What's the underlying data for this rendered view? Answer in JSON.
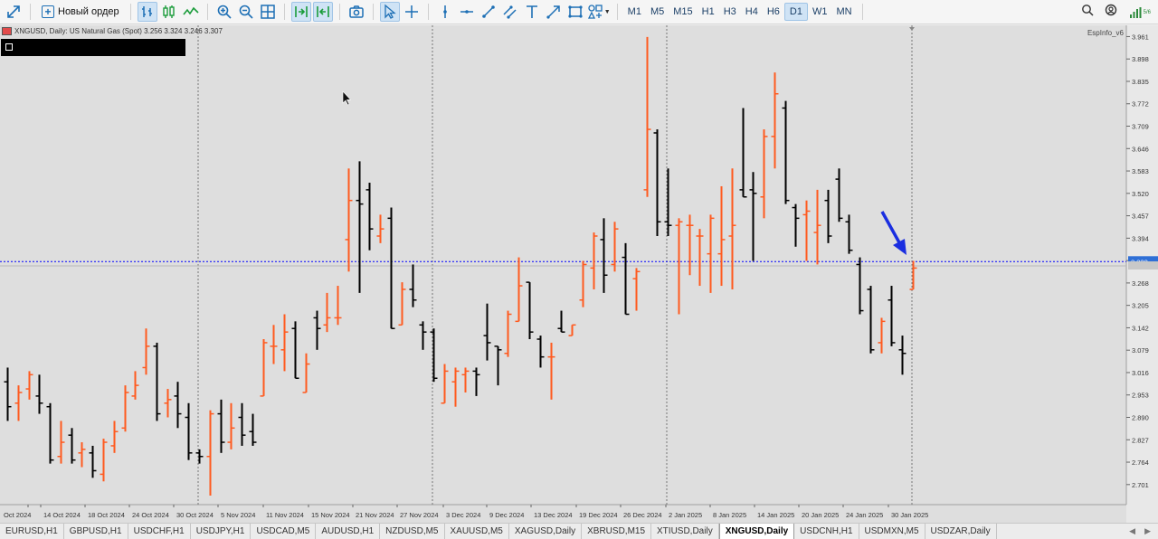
{
  "toolbar": {
    "new_order_label": "Новый ордер",
    "timeframes": [
      "M1",
      "M5",
      "M15",
      "H1",
      "H3",
      "H4",
      "H6",
      "D1",
      "W1",
      "MN"
    ],
    "active_timeframe": "D1",
    "icons": [
      "expand-icon",
      "new-order-icon",
      "bar-chart-icon",
      "candles-icon",
      "line-chart-icon",
      "zoom-in-icon",
      "zoom-out-icon",
      "grid-icon",
      "autoscroll-icon",
      "chart-shift-icon",
      "screenshot-icon",
      "cursor-icon",
      "crosshair-icon",
      "vertical-line-icon",
      "horizontal-line-icon",
      "trendline-icon",
      "channel-icon",
      "text-icon",
      "arrow-icon",
      "rectangle-icon",
      "shapes-icon",
      "search-icon",
      "community-icon",
      "signal-icon"
    ]
  },
  "chart": {
    "symbol_line": "XNGUSD, Daily:  US Natural Gas (Spot)  3.256 3.324 3.246 3.307",
    "indicator_label": "EspInfo_v6",
    "current_price_label": "3.328",
    "grid_line_color": "#0000ff",
    "up_color": "#ff5a1f",
    "down_color": "#000000",
    "price_ticks": [
      "3.961",
      "3.898",
      "3.835",
      "3.772",
      "3.709",
      "3.646",
      "3.583",
      "3.520",
      "3.457",
      "3.394",
      "3.331",
      "3.268",
      "3.205",
      "3.142",
      "3.079",
      "3.016",
      "2.953",
      "2.890",
      "2.827",
      "2.764",
      "2.701"
    ],
    "date_ticks": [
      "Oct 2024",
      "14 Oct 2024",
      "18 Oct 2024",
      "24 Oct 2024",
      "30 Oct 2024",
      "5 Nov 2024",
      "11 Nov 2024",
      "15 Nov 2024",
      "21 Nov 2024",
      "27 Nov 2024",
      "3 Dec 2024",
      "9 Dec 2024",
      "13 Dec 2024",
      "19 Dec 2024",
      "26 Dec 2024",
      "2 Jan 2025",
      "8 Jan 2025",
      "14 Jan 2025",
      "20 Jan 2025",
      "24 Jan 2025",
      "30 Jan 2025"
    ]
  },
  "chart_data": {
    "type": "ohlc",
    "symbol": "XNGUSD",
    "timeframe": "Daily",
    "ylim": [
      2.67,
      3.985
    ],
    "bars": [
      {
        "o": 2.99,
        "h": 3.03,
        "l": 2.88,
        "c": 2.92
      },
      {
        "o": 2.93,
        "h": 2.98,
        "l": 2.88,
        "c": 2.96
      },
      {
        "o": 2.97,
        "h": 3.02,
        "l": 2.94,
        "c": 3.01
      },
      {
        "o": 2.95,
        "h": 3.01,
        "l": 2.9,
        "c": 2.93
      },
      {
        "o": 2.92,
        "h": 2.93,
        "l": 2.76,
        "c": 2.77
      },
      {
        "o": 2.78,
        "h": 2.88,
        "l": 2.76,
        "c": 2.82
      },
      {
        "o": 2.84,
        "h": 2.86,
        "l": 2.76,
        "c": 2.77
      },
      {
        "o": 2.79,
        "h": 2.82,
        "l": 2.75,
        "c": 2.8
      },
      {
        "o": 2.79,
        "h": 2.81,
        "l": 2.72,
        "c": 2.74
      },
      {
        "o": 2.73,
        "h": 2.83,
        "l": 2.71,
        "c": 2.82
      },
      {
        "o": 2.81,
        "h": 2.88,
        "l": 2.79,
        "c": 2.85
      },
      {
        "o": 2.86,
        "h": 2.98,
        "l": 2.85,
        "c": 2.96
      },
      {
        "o": 2.95,
        "h": 3.02,
        "l": 2.94,
        "c": 2.98
      },
      {
        "o": 3.03,
        "h": 3.14,
        "l": 3.01,
        "c": 3.09
      },
      {
        "o": 3.09,
        "h": 3.1,
        "l": 2.88,
        "c": 2.9
      },
      {
        "o": 2.93,
        "h": 2.97,
        "l": 2.89,
        "c": 2.94
      },
      {
        "o": 2.95,
        "h": 2.99,
        "l": 2.86,
        "c": 2.9
      },
      {
        "o": 2.89,
        "h": 2.93,
        "l": 2.77,
        "c": 2.79
      },
      {
        "o": 2.79,
        "h": 2.8,
        "l": 2.76,
        "c": 2.78
      },
      {
        "o": 2.78,
        "h": 2.91,
        "l": 2.67,
        "c": 2.9
      },
      {
        "o": 2.9,
        "h": 2.94,
        "l": 2.79,
        "c": 2.82
      },
      {
        "o": 2.82,
        "h": 2.93,
        "l": 2.8,
        "c": 2.86
      },
      {
        "o": 2.89,
        "h": 2.93,
        "l": 2.81,
        "c": 2.84
      },
      {
        "o": 2.85,
        "h": 2.9,
        "l": 2.81,
        "c": 2.82
      },
      {
        "o": 2.95,
        "h": 3.11,
        "l": 2.95,
        "c": 3.1
      },
      {
        "o": 3.09,
        "h": 3.15,
        "l": 3.04,
        "c": 3.09
      },
      {
        "o": 3.08,
        "h": 3.18,
        "l": 3.02,
        "c": 3.13
      },
      {
        "o": 3.14,
        "h": 3.16,
        "l": 3.0,
        "c": 3.0
      },
      {
        "o": 2.96,
        "h": 3.07,
        "l": 2.96,
        "c": 3.04
      },
      {
        "o": 3.17,
        "h": 3.19,
        "l": 3.08,
        "c": 3.14
      },
      {
        "o": 3.15,
        "h": 3.24,
        "l": 3.13,
        "c": 3.17
      },
      {
        "o": 3.17,
        "h": 3.26,
        "l": 3.15,
        "c": 3.17
      },
      {
        "o": 3.39,
        "h": 3.59,
        "l": 3.3,
        "c": 3.5
      },
      {
        "o": 3.5,
        "h": 3.61,
        "l": 3.24,
        "c": 3.49
      },
      {
        "o": 3.53,
        "h": 3.55,
        "l": 3.36,
        "c": 3.42
      },
      {
        "o": 3.4,
        "h": 3.46,
        "l": 3.38,
        "c": 3.42
      },
      {
        "o": 3.45,
        "h": 3.48,
        "l": 3.14,
        "c": 3.14
      },
      {
        "o": 3.15,
        "h": 3.27,
        "l": 3.15,
        "c": 3.25
      },
      {
        "o": 3.25,
        "h": 3.32,
        "l": 3.2,
        "c": 3.22
      },
      {
        "o": 3.15,
        "h": 3.16,
        "l": 3.08,
        "c": 3.13
      },
      {
        "o": 3.13,
        "h": 3.14,
        "l": 2.99,
        "c": 3.0
      },
      {
        "o": 2.93,
        "h": 3.04,
        "l": 2.93,
        "c": 3.02
      },
      {
        "o": 2.99,
        "h": 3.03,
        "l": 2.92,
        "c": 3.02
      },
      {
        "o": 3.01,
        "h": 3.03,
        "l": 2.96,
        "c": 3.02
      },
      {
        "o": 3.02,
        "h": 3.03,
        "l": 2.95,
        "c": 3.01
      },
      {
        "o": 3.12,
        "h": 3.21,
        "l": 3.05,
        "c": 3.1
      },
      {
        "o": 3.09,
        "h": 3.09,
        "l": 2.98,
        "c": 3.08
      },
      {
        "o": 3.07,
        "h": 3.19,
        "l": 3.06,
        "c": 3.18
      },
      {
        "o": 3.16,
        "h": 3.34,
        "l": 3.16,
        "c": 3.26
      },
      {
        "o": 3.27,
        "h": 3.27,
        "l": 3.11,
        "c": 3.13
      },
      {
        "o": 3.11,
        "h": 3.12,
        "l": 3.03,
        "c": 3.06
      },
      {
        "o": 3.06,
        "h": 3.1,
        "l": 2.94,
        "c": 3.06
      },
      {
        "o": 3.14,
        "h": 3.19,
        "l": 3.13,
        "c": 3.13
      },
      {
        "o": 3.12,
        "h": 3.13,
        "l": 3.15,
        "c": 3.15
      },
      {
        "o": 3.22,
        "h": 3.33,
        "l": 3.2,
        "c": 3.32
      },
      {
        "o": 3.31,
        "h": 3.41,
        "l": 3.25,
        "c": 3.4
      },
      {
        "o": 3.39,
        "h": 3.45,
        "l": 3.24,
        "c": 3.29
      },
      {
        "o": 3.32,
        "h": 3.44,
        "l": 3.3,
        "c": 3.42
      },
      {
        "o": 3.34,
        "h": 3.38,
        "l": 3.18,
        "c": 3.18
      },
      {
        "o": 3.28,
        "h": 3.31,
        "l": 3.19,
        "c": 3.3
      },
      {
        "o": 3.53,
        "h": 3.96,
        "l": 3.51,
        "c": 3.7
      },
      {
        "o": 3.69,
        "h": 3.7,
        "l": 3.4,
        "c": 3.44
      },
      {
        "o": 3.44,
        "h": 3.59,
        "l": 3.4,
        "c": 3.43
      },
      {
        "o": 3.43,
        "h": 3.45,
        "l": 3.18,
        "c": 3.44
      },
      {
        "o": 3.43,
        "h": 3.46,
        "l": 3.29,
        "c": 3.43
      },
      {
        "o": 3.4,
        "h": 3.42,
        "l": 3.26,
        "c": 3.4
      },
      {
        "o": 3.35,
        "h": 3.46,
        "l": 3.24,
        "c": 3.45
      },
      {
        "o": 3.35,
        "h": 3.54,
        "l": 3.26,
        "c": 3.39
      },
      {
        "o": 3.4,
        "h": 3.59,
        "l": 3.25,
        "c": 3.43
      },
      {
        "o": 3.53,
        "h": 3.76,
        "l": 3.52,
        "c": 3.51
      },
      {
        "o": 3.53,
        "h": 3.58,
        "l": 3.33,
        "c": 3.52
      },
      {
        "o": 3.51,
        "h": 3.7,
        "l": 3.45,
        "c": 3.68
      },
      {
        "o": 3.68,
        "h": 3.86,
        "l": 3.59,
        "c": 3.8
      },
      {
        "o": 3.76,
        "h": 3.78,
        "l": 3.49,
        "c": 3.5
      },
      {
        "o": 3.48,
        "h": 3.49,
        "l": 3.37,
        "c": 3.45
      },
      {
        "o": 3.46,
        "h": 3.5,
        "l": 3.33,
        "c": 3.47
      },
      {
        "o": 3.41,
        "h": 3.53,
        "l": 3.32,
        "c": 3.43
      },
      {
        "o": 3.5,
        "h": 3.53,
        "l": 3.38,
        "c": 3.4
      },
      {
        "o": 3.56,
        "h": 3.59,
        "l": 3.44,
        "c": 3.45
      },
      {
        "o": 3.44,
        "h": 3.46,
        "l": 3.35,
        "c": 3.36
      },
      {
        "o": 3.32,
        "h": 3.34,
        "l": 3.18,
        "c": 3.19
      },
      {
        "o": 3.25,
        "h": 3.26,
        "l": 3.07,
        "c": 3.08
      },
      {
        "o": 3.1,
        "h": 3.17,
        "l": 3.07,
        "c": 3.16
      },
      {
        "o": 3.22,
        "h": 3.26,
        "l": 3.09,
        "c": 3.1
      },
      {
        "o": 3.08,
        "h": 3.12,
        "l": 3.01,
        "c": 3.07
      },
      {
        "o": 3.25,
        "h": 3.33,
        "l": 3.25,
        "c": 3.31
      }
    ]
  },
  "tabs": [
    {
      "label": "EURUSD,H1",
      "active": false
    },
    {
      "label": "GBPUSD,H1",
      "active": false
    },
    {
      "label": "USDCHF,H1",
      "active": false
    },
    {
      "label": "USDJPY,H1",
      "active": false
    },
    {
      "label": "USDCAD,M5",
      "active": false
    },
    {
      "label": "AUDUSD,H1",
      "active": false
    },
    {
      "label": "NZDUSD,M5",
      "active": false
    },
    {
      "label": "XAUUSD,M5",
      "active": false
    },
    {
      "label": "XAGUSD,Daily",
      "active": false
    },
    {
      "label": "XBRUSD,M15",
      "active": false
    },
    {
      "label": "XTIUSD,Daily",
      "active": false
    },
    {
      "label": "XNGUSD,Daily",
      "active": true
    },
    {
      "label": "USDCNH,H1",
      "active": false
    },
    {
      "label": "USDMXN,M5",
      "active": false
    },
    {
      "label": "USDZAR,Daily",
      "active": false
    }
  ]
}
